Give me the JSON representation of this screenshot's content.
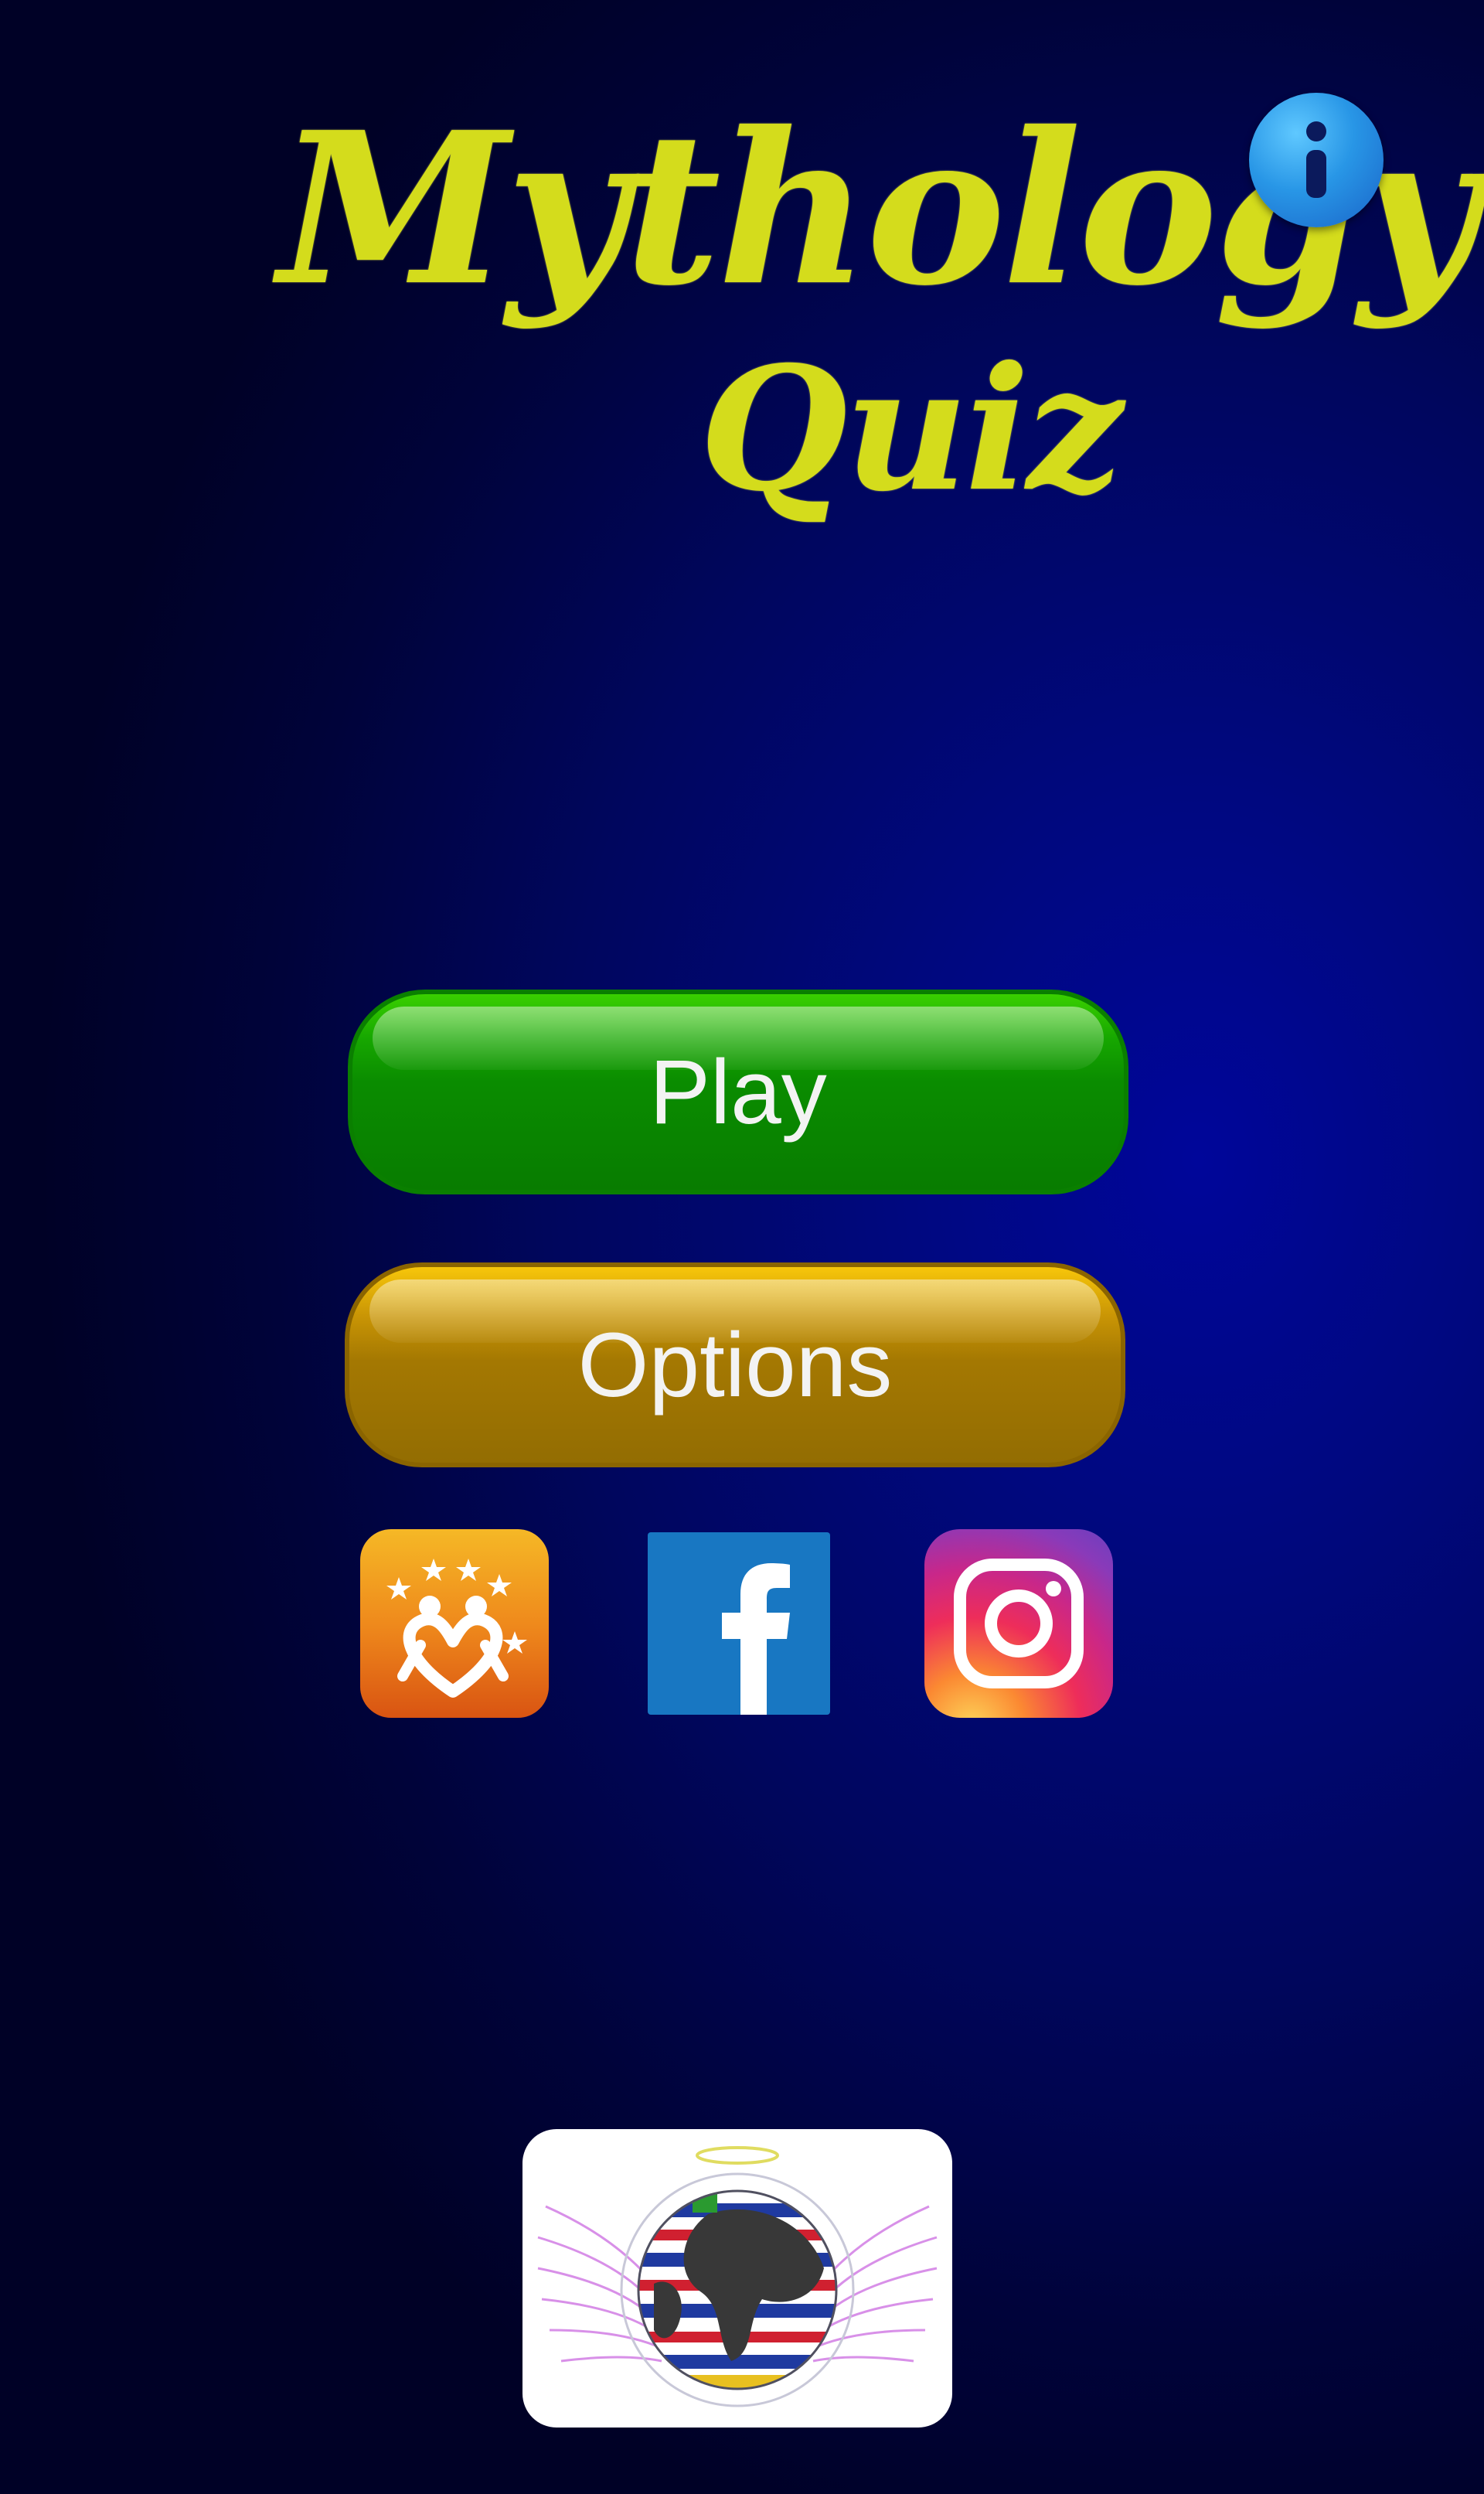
{
  "title": {
    "line1": "Mythology",
    "line2": "Quiz"
  },
  "header": {
    "info_icon": "info-icon"
  },
  "menu": {
    "play_label": "Play",
    "options_label": "Options"
  },
  "social": {
    "icons": [
      "app-logo-icon",
      "facebook-icon",
      "instagram-icon"
    ]
  },
  "footer": {
    "logo": "globe-angel-wings-logo"
  },
  "colors": {
    "background": "#000880",
    "title": "#d4dc1c",
    "play_button": "#0a8c00",
    "options_button": "#a47802",
    "info_button": "#2896e6",
    "facebook": "#1877c2"
  }
}
